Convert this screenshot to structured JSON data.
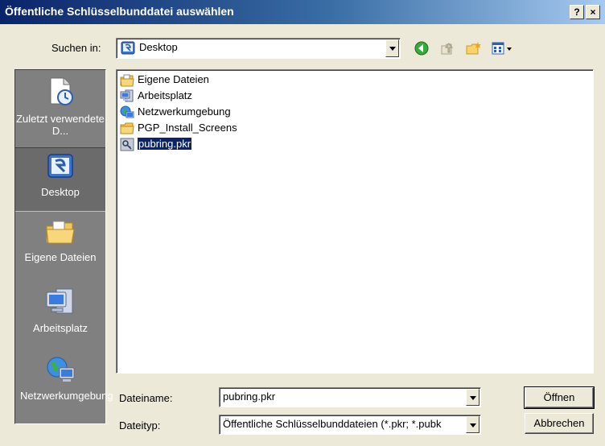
{
  "window": {
    "title": "Öffentliche Schlüsselbunddatei auswählen",
    "help_button": "?",
    "close_button": "×"
  },
  "lookin": {
    "label": "Suchen in:",
    "value": "Desktop",
    "icon": "desktop-icon"
  },
  "toolbar": {
    "back_icon": "back-arrow-icon",
    "up_icon": "up-folder-icon",
    "new_folder_icon": "new-folder-icon",
    "view_icon": "view-menu-icon"
  },
  "places": [
    {
      "label": "Zuletzt verwendete D...",
      "icon": "recent-documents-icon",
      "selected": false
    },
    {
      "label": "Desktop",
      "icon": "desktop-icon",
      "selected": true
    },
    {
      "label": "Eigene Dateien",
      "icon": "my-documents-icon",
      "selected": false
    },
    {
      "label": "Arbeitsplatz",
      "icon": "my-computer-icon",
      "selected": false
    },
    {
      "label": "Netzwerkumgebung",
      "icon": "network-icon",
      "selected": false
    }
  ],
  "files": [
    {
      "name": "Eigene Dateien",
      "icon": "my-documents-icon",
      "selected": false
    },
    {
      "name": "Arbeitsplatz",
      "icon": "my-computer-icon",
      "selected": false
    },
    {
      "name": "Netzwerkumgebung",
      "icon": "network-icon",
      "selected": false
    },
    {
      "name": "PGP_Install_Screens",
      "icon": "folder-icon",
      "selected": false
    },
    {
      "name": "pubring.pkr",
      "icon": "keyring-file-icon",
      "selected": true
    }
  ],
  "filename": {
    "label": "Dateiname:",
    "value": "pubring.pkr"
  },
  "filetype": {
    "label": "Dateityp:",
    "value": "Öffentliche Schlüsselbunddateien (*.pkr; *.pubk"
  },
  "buttons": {
    "open": "Öffnen",
    "cancel": "Abbrechen"
  },
  "colors": {
    "titlebar_start": "#0a246a",
    "titlebar_end": "#a6caf0",
    "selection": "#0a246a",
    "dialog_bg": "#ece9d8",
    "places_bg": "#808080"
  }
}
